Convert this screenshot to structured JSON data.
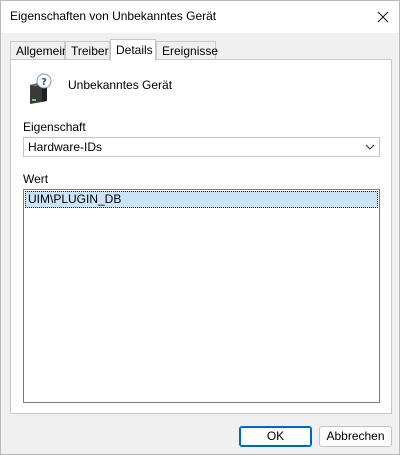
{
  "window": {
    "title": "Eigenschaften von Unbekanntes Gerät"
  },
  "tabs": [
    {
      "label": "Allgemein",
      "active": false
    },
    {
      "label": "Treiber",
      "active": false
    },
    {
      "label": "Details",
      "active": true
    },
    {
      "label": "Ereignisse",
      "active": false
    }
  ],
  "device": {
    "name": "Unbekanntes Gerät",
    "icon": "unknown-device-icon"
  },
  "property": {
    "label": "Eigenschaft",
    "selected": "Hardware-IDs"
  },
  "value": {
    "label": "Wert",
    "items": [
      "UIM\\PLUGIN_DB"
    ]
  },
  "buttons": {
    "ok": "OK",
    "cancel": "Abbrechen"
  },
  "colors": {
    "selection": "#cce4f7",
    "default_button_border": "#0067c0"
  }
}
